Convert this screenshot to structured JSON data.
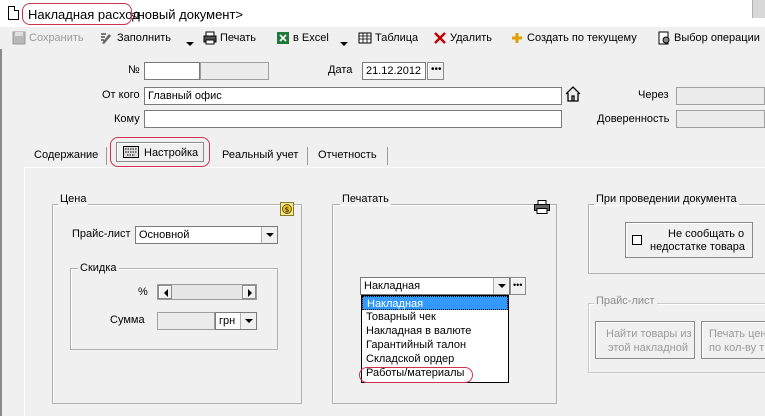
{
  "window": {
    "title_main": "Накладная расход",
    "title_sub": "<новый документ>"
  },
  "toolbar": {
    "save": "Сохранить",
    "fill": "Заполнить",
    "print": "Печать",
    "excel": "в Excel",
    "table": "Таблица",
    "delete": "Удалить",
    "create_by": "Создать по текущему",
    "select_op": "Выбор операции"
  },
  "header": {
    "number_label": "№",
    "number_value": "",
    "date_label": "Дата",
    "date_value": "21.12.2012",
    "from_label": "От кого",
    "from_value": "Главный офис",
    "to_label": "Кому",
    "to_value": "",
    "via_label": "Через",
    "proxy_label": "Доверенность"
  },
  "tabs": [
    {
      "label": "Содержание"
    },
    {
      "label": "Настройка"
    },
    {
      "label": "Реальный учет"
    },
    {
      "label": "Отчетность"
    }
  ],
  "price_group": {
    "title": "Цена",
    "pricelist_label": "Прайс-лист",
    "pricelist_value": "Основной",
    "discount_title": "Скидка",
    "percent_label": "%",
    "sum_label": "Сумма",
    "currency": "грн"
  },
  "print_group": {
    "title": "Печатать",
    "selected": "Накладная",
    "options": [
      "Накладная",
      "Товарный чек",
      "Накладная в валюте",
      "Гарантийный талон",
      "Складской ордер",
      "Работы/материалы"
    ]
  },
  "posting_group": {
    "title": "При проведении документа",
    "no_report_line1": "Не сообщать о",
    "no_report_line2": "недостатке товара"
  },
  "pricelist_group": {
    "title": "Прайс-лист",
    "find_line1": "Найти товары из",
    "find_line2": "этой накладной",
    "print_price_line1": "Печать цен",
    "print_price_line2": "по кол-ву т"
  }
}
